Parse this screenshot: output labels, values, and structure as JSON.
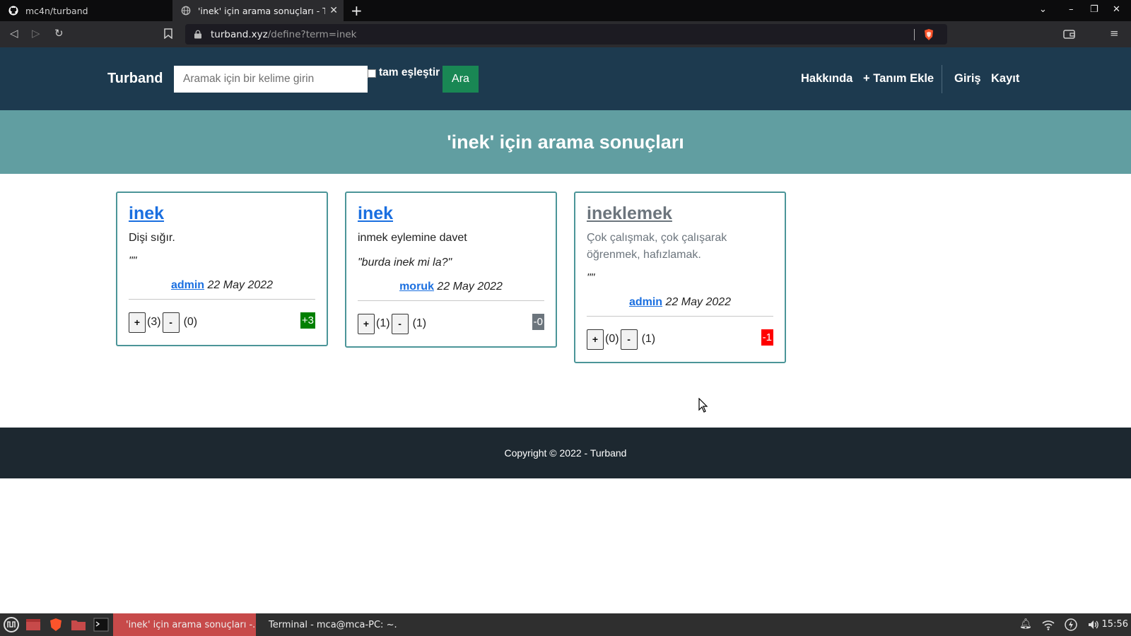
{
  "browser": {
    "tabs": [
      {
        "title": "mc4n/turband",
        "icon": "github-icon"
      },
      {
        "title": "'inek' için arama sonuçları - Tu",
        "icon": "globe-icon"
      }
    ],
    "url_host": "turband.xyz",
    "url_path": "/define?term=inek"
  },
  "header": {
    "brand": "Turband",
    "search_placeholder": "Aramak için bir kelime girin",
    "exact_match_label": "tam eşleştir",
    "search_button": "Ara",
    "nav": {
      "about": "Hakkında",
      "add_definition": "+ Tanım Ekle",
      "login": "Giriş",
      "register": "Kayıt"
    }
  },
  "hero": {
    "title": "'inek' için arama sonuçları"
  },
  "cards": [
    {
      "word": "inek",
      "definition": "Dişi sığır.",
      "example": "\"\"",
      "author": "admin",
      "date": "22 May 2022",
      "up_label": "+",
      "up_count": "(3)",
      "down_label": "-",
      "down_count": "(0)",
      "score": "+3",
      "score_color": "#008000"
    },
    {
      "word": "inek",
      "definition": "inmek eylemine davet",
      "example": "\"burda inek mi la?\"",
      "author": "moruk",
      "date": "22 May 2022",
      "up_label": "+",
      "up_count": "(1)",
      "down_label": "-",
      "down_count": "(1)",
      "score": "-0",
      "score_color": "#6c757d"
    },
    {
      "word": "ineklemek",
      "definition": "Çok çalışmak, çok çalışarak öğrenmek, hafızlamak.",
      "example": "\"\"",
      "author": "admin",
      "date": "22 May 2022",
      "up_label": "+",
      "up_count": "(0)",
      "down_label": "-",
      "down_count": "(1)",
      "score": "-1",
      "score_color": "#ff0000"
    }
  ],
  "footer": {
    "copyright": "Copyright © 2022 - Turband"
  },
  "taskbar": {
    "items": [
      "'inek' için arama sonuçları -...",
      "Terminal - mca@mca-PC: ~..."
    ],
    "clock": "15:56"
  }
}
